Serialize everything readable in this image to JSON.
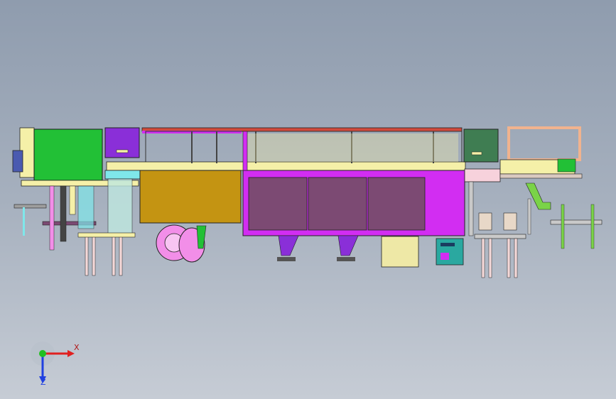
{
  "viewport": {
    "background_top": "#8f9cae",
    "background_bottom": "#c6ccd5"
  },
  "model": {
    "colors": {
      "frame_yellow": "#f5f0a8",
      "frame_outline": "#222222",
      "green_cabinet": "#22c036",
      "purple_box": "#8a2fd8",
      "magenta_cabinet": "#d22df2",
      "panel_purple": "#7c4a73",
      "brown_panel": "#c49412",
      "dark_green_box": "#3f7d52",
      "salmon_frame": "#f1b38e",
      "pink_pump": "#f28ee8",
      "red_rail": "#d14a3c",
      "control_box": "#2aa8a0",
      "steel": "#c9c9c9",
      "cyan_base": "#7fe7ea",
      "olive_cylinder": "#eee8a6",
      "lime": "#7ad348"
    }
  },
  "triad": {
    "x_label": "X",
    "z_label": "Z",
    "x_color": "#e02020",
    "y_color": "#20c020",
    "z_color": "#2040e0"
  }
}
